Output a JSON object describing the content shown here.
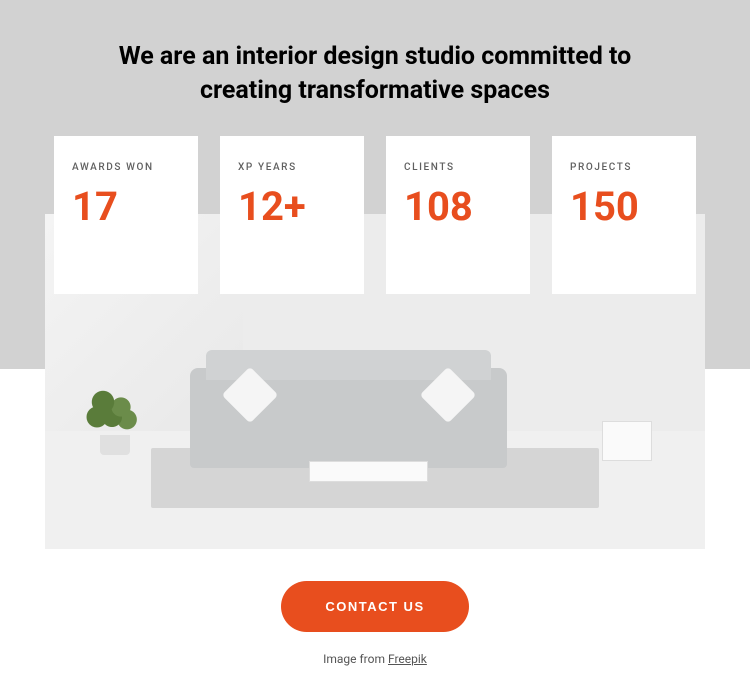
{
  "hero": {
    "heading": "We are an interior design studio committed to creating transformative spaces"
  },
  "stats": [
    {
      "label": "AWARDS WON",
      "value": "17"
    },
    {
      "label": "XP YEARS",
      "value": "12+"
    },
    {
      "label": "CLIENTS",
      "value": "108"
    },
    {
      "label": "PROJECTS",
      "value": "150"
    }
  ],
  "cta": {
    "label": "CONTACT US"
  },
  "credit": {
    "prefix": "Image from ",
    "link_text": "Freepik"
  },
  "colors": {
    "accent": "#e84e1e",
    "hero_bg": "#d2d2d2"
  }
}
